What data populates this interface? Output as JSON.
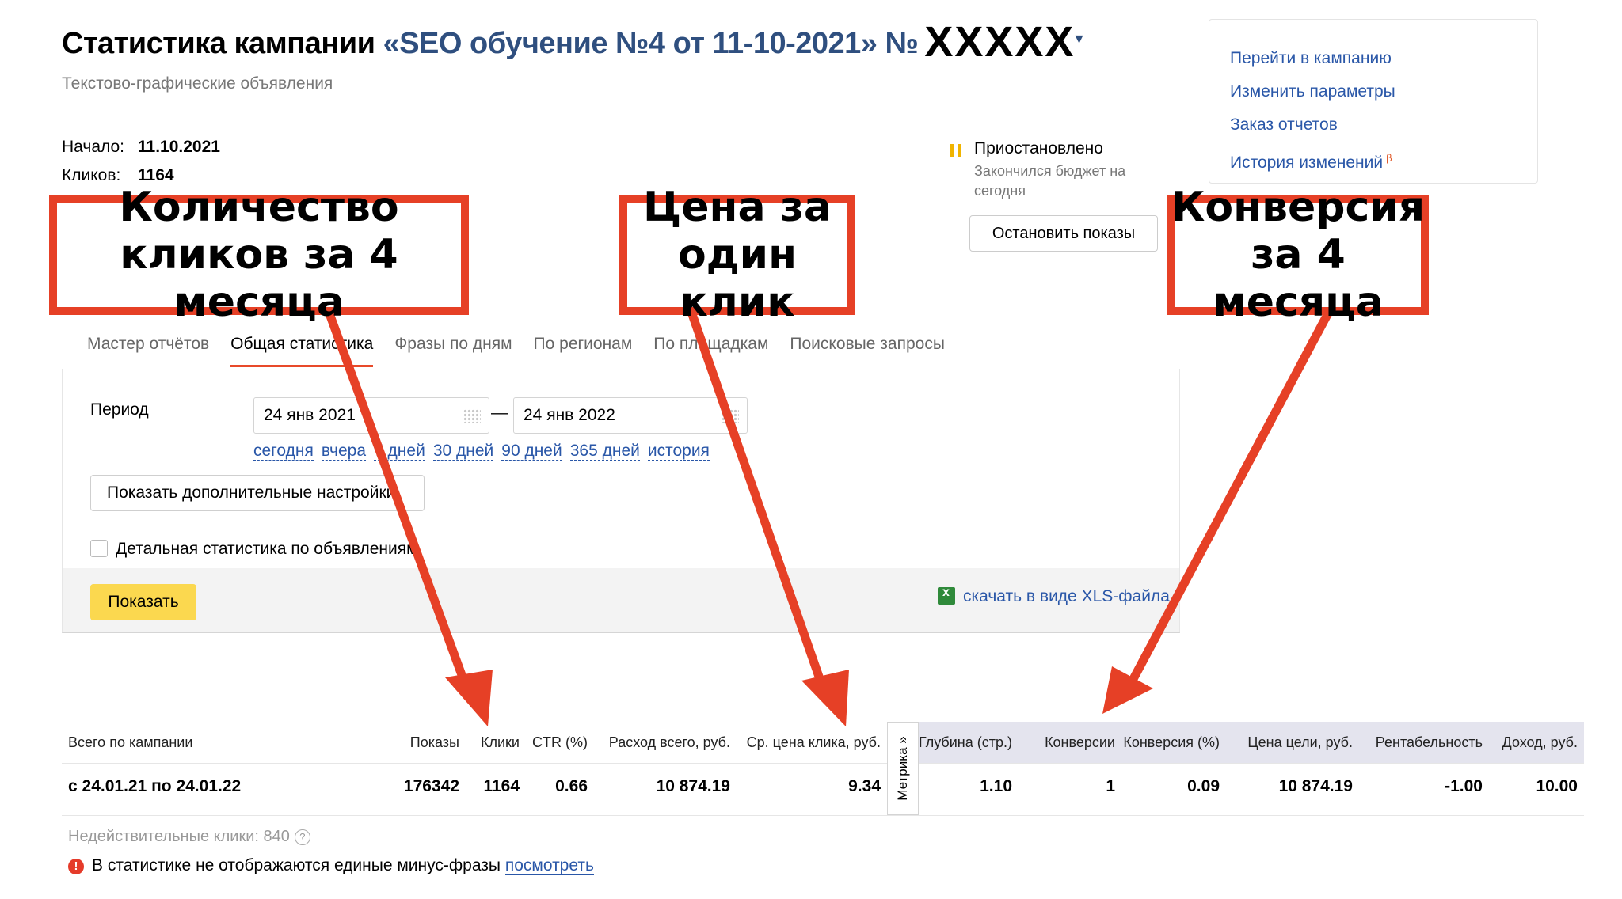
{
  "header": {
    "title_prefix": "Статистика кампании ",
    "title_campaign": "«SEO обучение №4 от 11-10-2021» №",
    "title_masked": "XXXXX",
    "caret": "▾",
    "subtitle": "Текстово-графические объявления"
  },
  "info": {
    "start_label": "Начало:",
    "start_value": "11.10.2021",
    "clicks_label": "Кликов:",
    "clicks_value": "1164"
  },
  "status": {
    "title": "Приостановлено",
    "subtitle": "Закончился бюджет на сегодня",
    "stop_button": "Остановить показы"
  },
  "menu": {
    "items": [
      "Перейти в кампанию",
      "Изменить параметры",
      "Заказ отчетов",
      "История изменений"
    ],
    "beta": "β"
  },
  "tabs": [
    "Мастер отчётов",
    "Общая статистика",
    "Фразы по дням",
    "По регионам",
    "По площадкам",
    "Поисковые запросы"
  ],
  "period": {
    "label": "Период",
    "from": "24 янв 2021",
    "dash": "—",
    "to": "24 янв 2022",
    "quick": [
      "сегодня",
      "вчера",
      "7 дней",
      "30 дней",
      "90 дней",
      "365 дней",
      "история"
    ]
  },
  "settings": {
    "more_button": "Показать дополнительные настройки",
    "detail_checkbox": "Детальная статистика по объявлениям",
    "show_button": "Показать",
    "xls_link": "скачать в виде XLS-файла"
  },
  "table": {
    "metrika": "Метрика »",
    "headers": [
      "Всего по кампании",
      "Показы",
      "Клики",
      "CTR (%)",
      "Расход всего, руб.",
      "Ср. цена клика, руб.",
      "Глубина (стр.)",
      "Конверсии",
      "Конверсия (%)",
      "Цена цели, руб.",
      "Рентабельность",
      "Доход, руб."
    ],
    "row": [
      "с 24.01.21 по 24.01.22",
      "176342",
      "1164",
      "0.66",
      "10 874.19",
      "9.34",
      "1.10",
      "1",
      "0.09",
      "10 874.19",
      "-1.00",
      "10.00"
    ]
  },
  "footer": {
    "invalid_clicks": "Недействительные клики: 840",
    "help": "?",
    "warning": "В статистике не отображаются единые минус-фразы",
    "warning_link": "посмотреть"
  },
  "annotations": {
    "clicks": "Количество кликов за 4 месяца",
    "cpc": "Цена за один клик",
    "conversion": "Конверсия за 4 месяца",
    "color": "#e64026"
  }
}
